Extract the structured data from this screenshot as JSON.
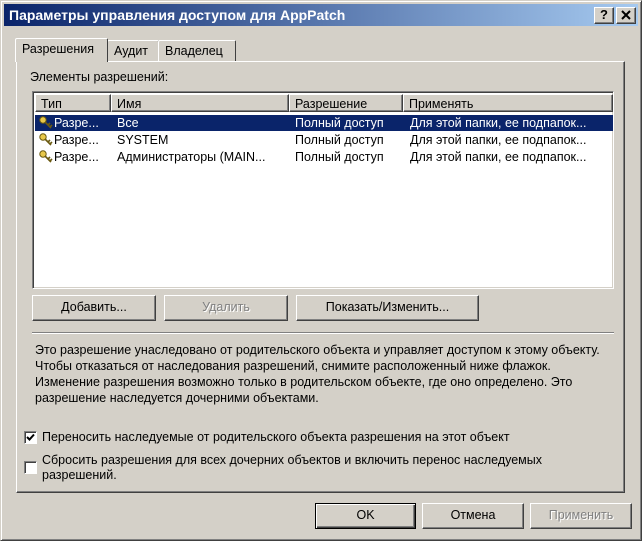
{
  "window": {
    "title": "Параметры управления доступом для AppPatch",
    "help_label": "?",
    "close_label": "×"
  },
  "tabs": [
    {
      "label": "Разрешения",
      "active": true
    },
    {
      "label": "Аудит",
      "active": false
    },
    {
      "label": "Владелец",
      "active": false
    }
  ],
  "permissions": {
    "list_label": "Элементы разрешений:",
    "columns": [
      "Тип",
      "Имя",
      "Разрешение",
      "Применять"
    ],
    "rows": [
      {
        "type": "Разре...",
        "name": "Все",
        "permission": "Полный доступ",
        "apply": "Для этой папки, ее подпапок...",
        "selected": true
      },
      {
        "type": "Разре...",
        "name": "SYSTEM",
        "permission": "Полный доступ",
        "apply": "Для этой папки, ее подпапок...",
        "selected": false
      },
      {
        "type": "Разре...",
        "name": "Администраторы (MAIN...",
        "permission": "Полный доступ",
        "apply": "Для этой папки, ее подпапок...",
        "selected": false
      }
    ]
  },
  "buttons": {
    "add": "Добавить...",
    "remove": "Удалить",
    "show_edit": "Показать/Изменить..."
  },
  "info_text": "Это разрешение унаследовано от родительского объекта и управляет доступом к этому объекту. Чтобы отказаться от наследования разрешений, снимите расположенный ниже флажок. Изменение разрешения возможно только в родительском объекте, где оно определено. Это разрешение наследуется дочерними объектами.",
  "checkboxes": [
    {
      "label": "Переносить наследуемые от родительского объекта разрешения на этот объект",
      "checked": true
    },
    {
      "label": "Сбросить разрешения для всех дочерних объектов и включить перенос наследуемых разрешений.",
      "checked": false
    }
  ],
  "footer": {
    "ok": "OK",
    "cancel": "Отмена",
    "apply": "Применить"
  },
  "colors": {
    "title_start": "#0a246a",
    "title_end": "#a6caf0",
    "selection": "#0a246a",
    "face": "#d4d0c8"
  }
}
